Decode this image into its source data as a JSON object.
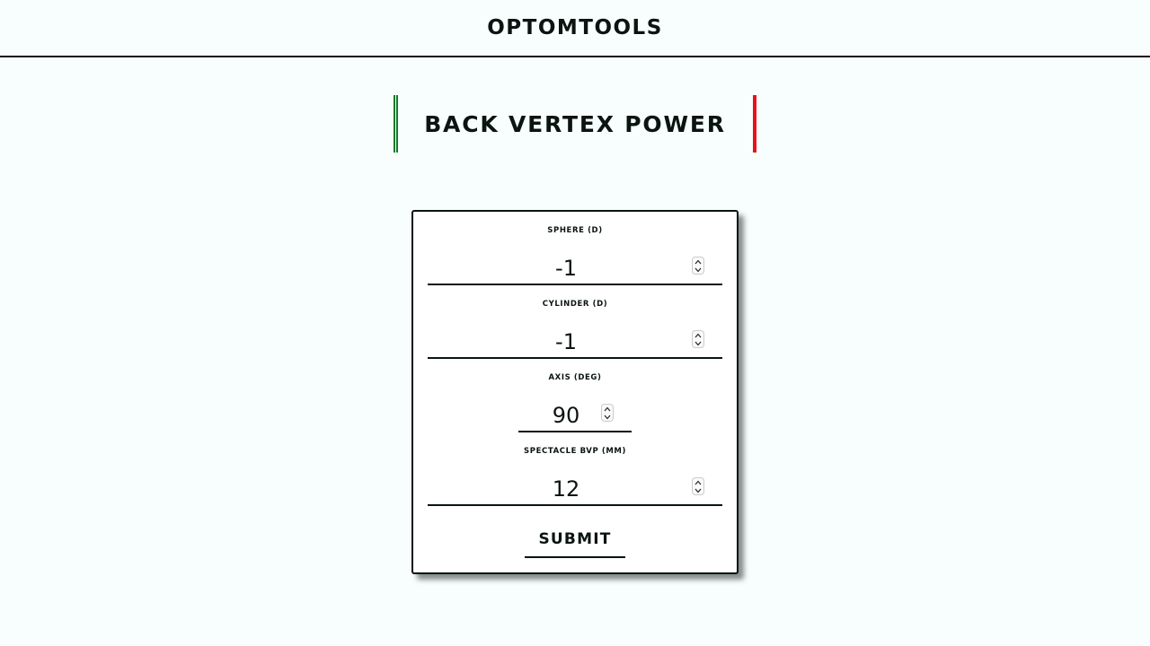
{
  "header": {
    "brand": "OPTOMTOOLS"
  },
  "page": {
    "title": "BACK VERTEX POWER"
  },
  "colors": {
    "left_bar": "#0f7a2a",
    "right_bar": "#e6141a"
  },
  "form": {
    "fields": [
      {
        "label": "SPHERE (D)",
        "value": "-1"
      },
      {
        "label": "CYLINDER (D)",
        "value": "-1"
      },
      {
        "label": "AXIS (DEG)",
        "value": "90"
      },
      {
        "label": "SPECTACLE BVP (MM)",
        "value": "12"
      }
    ],
    "submit_label": "SUBMIT"
  }
}
